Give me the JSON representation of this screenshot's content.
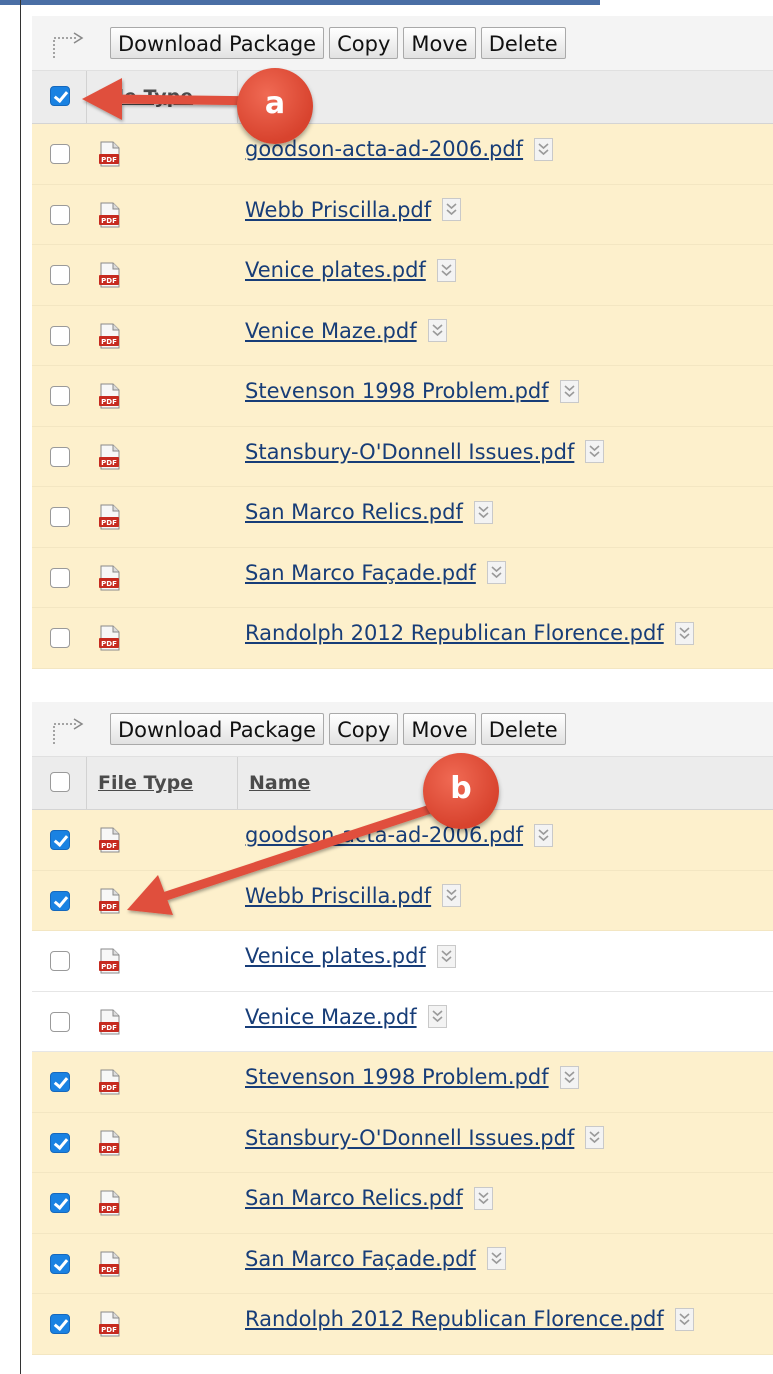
{
  "toolbar": {
    "buttons": [
      "Download Package",
      "Copy",
      "Move",
      "Delete"
    ]
  },
  "header": {
    "file_type": "File Type",
    "name": "Name"
  },
  "files": [
    "goodson-acta-ad-2006.pdf",
    "Webb Priscilla.pdf",
    "Venice plates.pdf",
    "Venice Maze.pdf",
    "Stevenson 1998 Problem.pdf",
    "Stansbury-O'Donnell Issues.pdf",
    "San Marco Relics.pdf",
    "San Marco Façade.pdf",
    "Randolph 2012 Republican Florence.pdf"
  ],
  "panel1": {
    "select_all_checked": true,
    "row_checked": [
      false,
      false,
      false,
      false,
      false,
      false,
      false,
      false,
      false
    ],
    "callout": "a"
  },
  "panel2": {
    "select_all_checked": false,
    "row_checked": [
      true,
      true,
      false,
      false,
      true,
      true,
      true,
      true,
      true
    ],
    "callout": "b"
  },
  "colors": {
    "selected_row": "#fdf0cc",
    "checkbox_checked": "#1a82e2",
    "callout": "#d8432e",
    "link": "#173d78"
  }
}
